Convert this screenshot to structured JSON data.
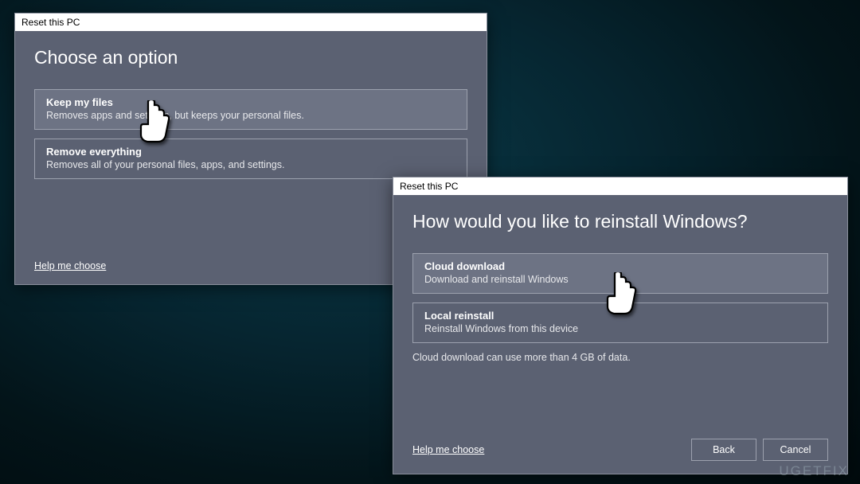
{
  "dialog1": {
    "title": "Reset this PC",
    "heading": "Choose an option",
    "options": [
      {
        "title": "Keep my files",
        "desc": "Removes apps and settings, but keeps your personal files."
      },
      {
        "title": "Remove everything",
        "desc": "Removes all of your personal files, apps, and settings."
      }
    ],
    "help_link": "Help me choose"
  },
  "dialog2": {
    "title": "Reset this PC",
    "heading": "How would you like to reinstall Windows?",
    "options": [
      {
        "title": "Cloud download",
        "desc": "Download and reinstall Windows"
      },
      {
        "title": "Local reinstall",
        "desc": "Reinstall Windows from this device"
      }
    ],
    "note": "Cloud download can use more than 4 GB of data.",
    "help_link": "Help me choose",
    "back_label": "Back",
    "cancel_label": "Cancel"
  },
  "watermark": "UGETFIX"
}
